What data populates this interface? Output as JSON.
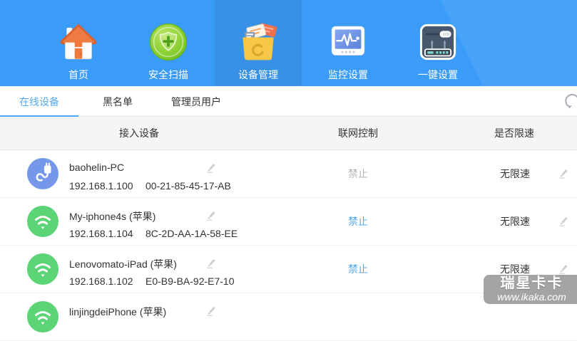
{
  "header": {
    "nav_items": [
      {
        "label": "首页",
        "icon": "home-icon"
      },
      {
        "label": "安全扫描",
        "icon": "security-scan-icon"
      },
      {
        "label": "设备管理",
        "icon": "device-manage-icon",
        "selected": true
      },
      {
        "label": "监控设置",
        "icon": "monitor-settings-icon"
      },
      {
        "label": "一键设置",
        "icon": "one-key-setup-icon"
      }
    ]
  },
  "tabs": [
    {
      "label": "在线设备",
      "active": true
    },
    {
      "label": "黑名单",
      "active": false
    },
    {
      "label": "管理员用户",
      "active": false
    }
  ],
  "table": {
    "columns": [
      "接入设备",
      "联网控制",
      "是否限速"
    ]
  },
  "rows": [
    {
      "icon": "usb-device-icon",
      "name": "baohelin-PC",
      "ip": "192.168.1.100",
      "mac": "00-21-85-45-17-AB",
      "control": "禁止",
      "control_enabled": false,
      "limit": "无限速"
    },
    {
      "icon": "wifi-device-icon",
      "name": "My-iphone4s (苹果)",
      "ip": "192.168.1.104",
      "mac": "8C-2D-AA-1A-58-EE",
      "control": "禁止",
      "control_enabled": true,
      "limit": "无限速"
    },
    {
      "icon": "wifi-device-icon",
      "name": "Lenovomato-iPad (苹果)",
      "ip": "192.168.1.102",
      "mac": "E0-B9-BA-92-E7-10",
      "control": "禁止",
      "control_enabled": true,
      "limit": "无限速"
    },
    {
      "icon": "wifi-device-icon",
      "name": "linjingdeiPhone (苹果)",
      "ip": "",
      "mac": "",
      "control": "",
      "limit": ""
    }
  ],
  "watermark": {
    "brand": "瑞星卡卡",
    "url": "www.ikaka.com"
  },
  "colors": {
    "header_blue": "#3a9cf8",
    "accent_blue": "#55a7ee",
    "disabled_gray": "#b3b3b3",
    "device_blue": "#7497ea",
    "device_green": "#5bd475"
  }
}
